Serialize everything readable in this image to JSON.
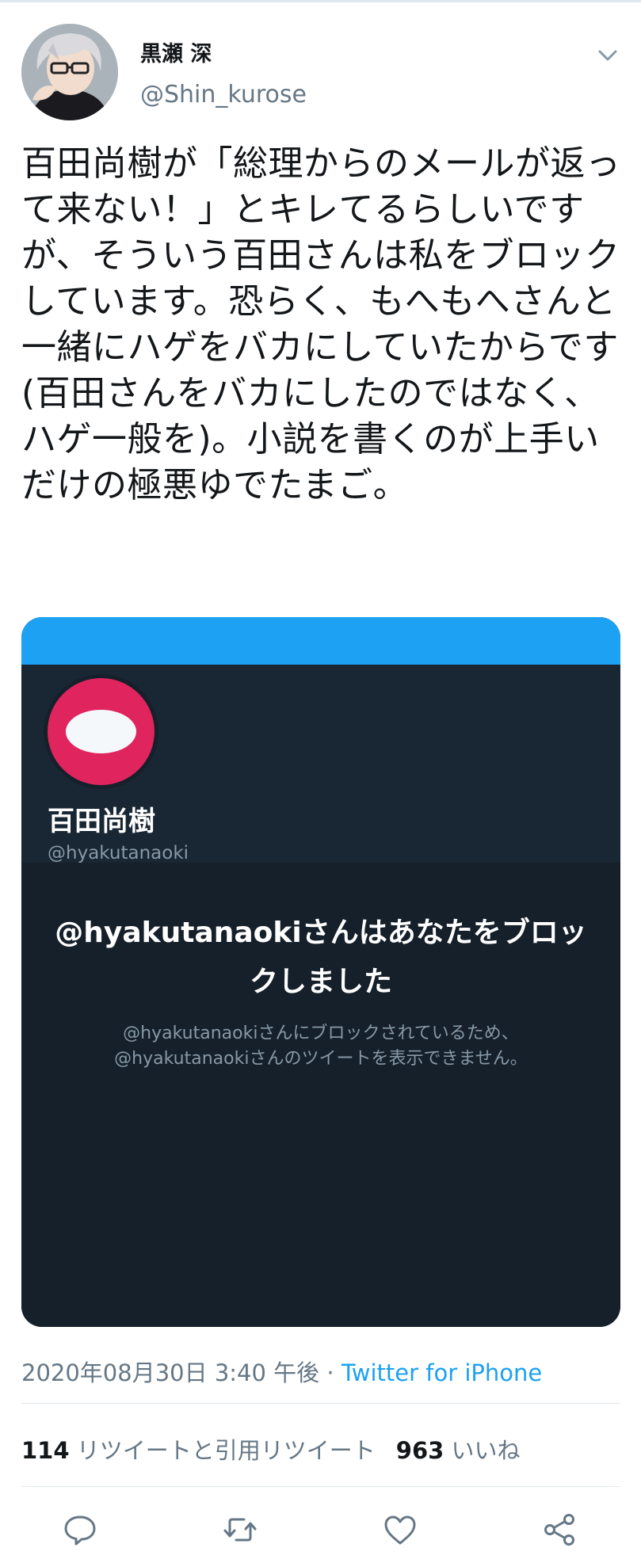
{
  "author": {
    "display_name": "黒瀬 深",
    "handle": "@Shin_kurose"
  },
  "tweet": {
    "text": "百田尚樹が「総理からのメールが返って来ない！」とキレてるらしいですが、そういう百田さんは私をブロックしています。恐らく、もへもへさんと一緒にハゲをバカにしていたからです(百田さんをバカにしたのではなく、ハゲ一般を)。小説を書くのが上手いだけの極悪ゆでたまご。"
  },
  "card": {
    "name": "百田尚樹",
    "handle": "@hyakutanaoki",
    "blocked_title": "@hyakutanaokiさんはあなたをブロックしました",
    "blocked_desc_1": "@hyakutanaokiさんにブロックされているため、",
    "blocked_desc_2": "@hyakutanaokiさんのツイートを表示できません。"
  },
  "meta": {
    "timestamp": "2020年08月30日 3:40 午後",
    "separator": " · ",
    "source": "Twitter for iPhone"
  },
  "stats": {
    "retweets_count": "114",
    "retweets_label": "リツイートと引用リツイート",
    "likes_count": "963",
    "likes_label": "いいね"
  },
  "colors": {
    "accent": "#1da1f2",
    "card_background": "#15202b",
    "card_avatar": "#e0245e",
    "secondary_text": "#657786"
  },
  "icons": [
    "chevron-down-icon",
    "reply-icon",
    "retweet-icon",
    "like-icon",
    "share-icon"
  ]
}
